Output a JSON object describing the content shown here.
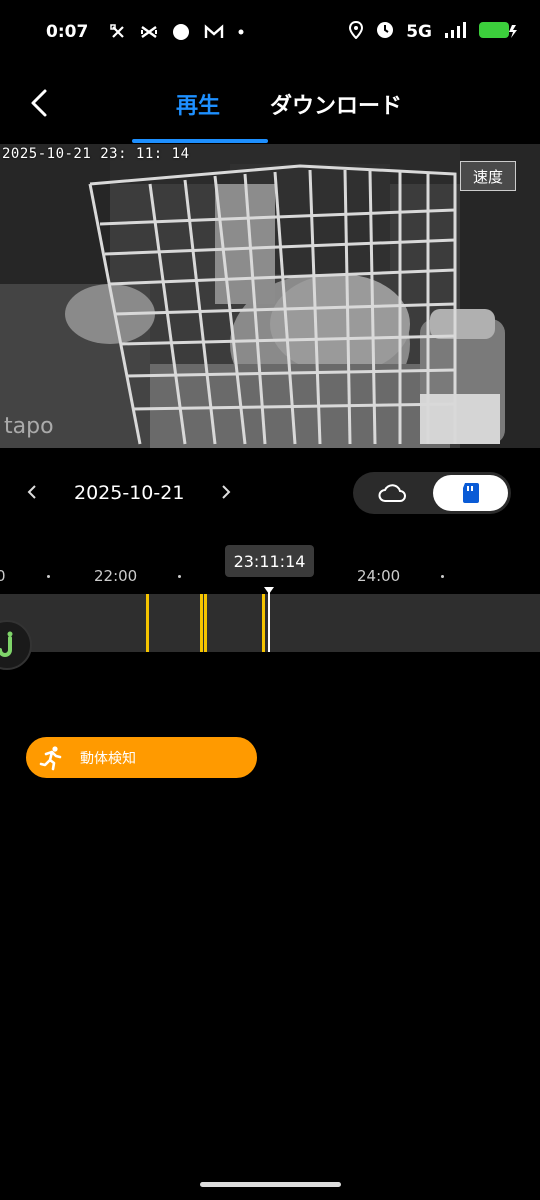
{
  "status_bar": {
    "time": "0:07",
    "network": "5G",
    "icons": [
      "cut-icon",
      "capcut-icon",
      "circle-icon",
      "gmail-icon",
      "dot-icon",
      "location-icon",
      "alarm-icon",
      "signal-icon",
      "battery-charging-icon"
    ]
  },
  "header": {
    "back_icon": "chevron-left-icon",
    "tabs": [
      {
        "label": "再生",
        "active": true
      },
      {
        "label": "ダウンロード",
        "active": false
      }
    ],
    "accent_color": "#1e90ff"
  },
  "video": {
    "timestamp": "2025-10-21  23: 11: 14",
    "speed_label": "速度",
    "watermark": "tapo"
  },
  "date_nav": {
    "date": "2025-10-21",
    "prev_icon": "chevron-left-icon",
    "next_icon": "chevron-right-icon",
    "storage": {
      "cloud_icon": "cloud-icon",
      "sd_icon": "sd-card-icon",
      "selected": "sd-card"
    }
  },
  "timeline": {
    "labels": [
      "0",
      "22:00",
      "24:00"
    ],
    "cursor_time": "23:11:14",
    "event_color": "#f5c400"
  },
  "filter_chip": {
    "label": "動体検知",
    "icon": "running-person-icon",
    "color": "#ff9a00"
  }
}
